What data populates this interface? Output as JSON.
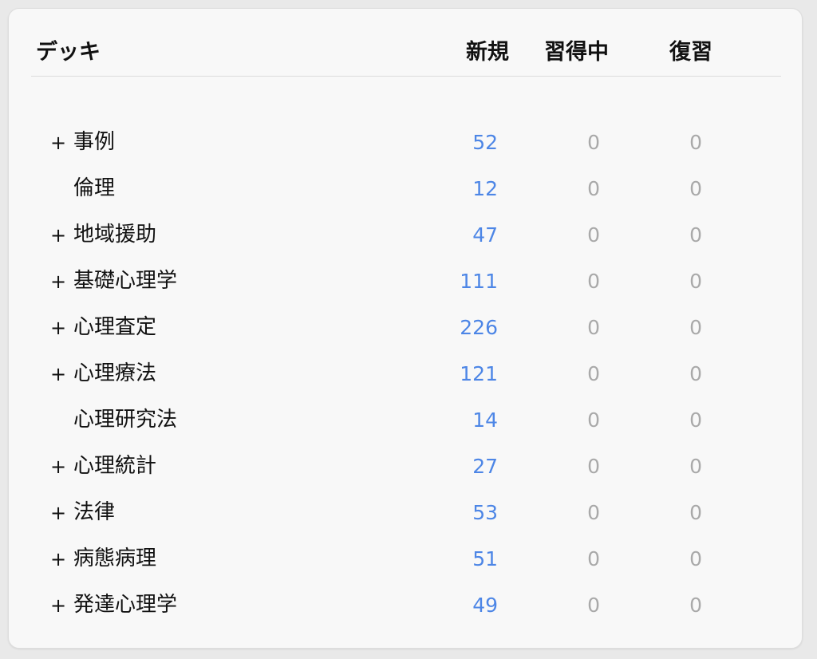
{
  "header": {
    "deck": "デッキ",
    "new": "新規",
    "learning": "習得中",
    "review": "復習"
  },
  "colors": {
    "new": "#4d86e6",
    "zero": "#a9a9a9"
  },
  "decks": [
    {
      "expander": "+",
      "name": "事例",
      "new": "52",
      "learning": "0",
      "review": "0"
    },
    {
      "expander": "",
      "name": "倫理",
      "new": "12",
      "learning": "0",
      "review": "0"
    },
    {
      "expander": "+",
      "name": "地域援助",
      "new": "47",
      "learning": "0",
      "review": "0"
    },
    {
      "expander": "+",
      "name": "基礎心理学",
      "new": "111",
      "learning": "0",
      "review": "0"
    },
    {
      "expander": "+",
      "name": "心理査定",
      "new": "226",
      "learning": "0",
      "review": "0"
    },
    {
      "expander": "+",
      "name": "心理療法",
      "new": "121",
      "learning": "0",
      "review": "0"
    },
    {
      "expander": "",
      "name": "心理研究法",
      "new": "14",
      "learning": "0",
      "review": "0"
    },
    {
      "expander": "+",
      "name": "心理統計",
      "new": "27",
      "learning": "0",
      "review": "0"
    },
    {
      "expander": "+",
      "name": "法律",
      "new": "53",
      "learning": "0",
      "review": "0"
    },
    {
      "expander": "+",
      "name": "病態病理",
      "new": "51",
      "learning": "0",
      "review": "0"
    },
    {
      "expander": "+",
      "name": "発達心理学",
      "new": "49",
      "learning": "0",
      "review": "0"
    }
  ]
}
